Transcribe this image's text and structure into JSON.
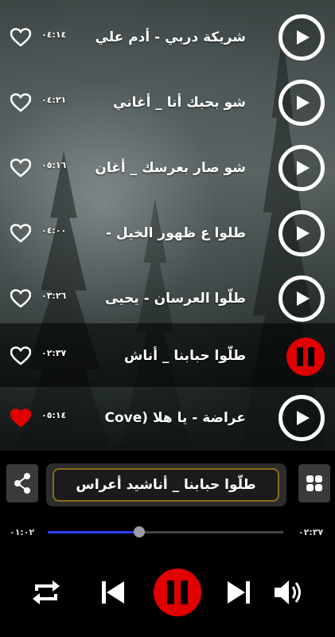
{
  "playlist": {
    "items": [
      {
        "title": "شريكة دربي - أدم علي",
        "duration": "٠٤:١٤",
        "favorite": false,
        "playing": false
      },
      {
        "title": "شو بحبك أنا _ أغاني",
        "duration": "٠٤:٢١",
        "favorite": false,
        "playing": false
      },
      {
        "title": "شو صار بعرسك _ أغان",
        "duration": "٠٥:١٦",
        "favorite": false,
        "playing": false
      },
      {
        "title": "طلوا ع ظهور الخيل -",
        "duration": "٠٤:٠٠",
        "favorite": false,
        "playing": false
      },
      {
        "title": "طلّوا العرسان - يحيى",
        "duration": "٠٣:٢٦",
        "favorite": false,
        "playing": false
      },
      {
        "title": "طلّوا حبابنا _ أناش",
        "duration": "٠٢:٣٧",
        "favorite": false,
        "playing": true
      },
      {
        "title": "عراضة - يا هلا (Cove",
        "duration": "٠٥:١٤",
        "favorite": true,
        "playing": false
      }
    ]
  },
  "player": {
    "now_playing": "طلّوا حبابنا _ أناشيد أعراس",
    "elapsed": "٠١:٠٢",
    "total": "٠٢:٣٧",
    "progress": 0.39
  },
  "colors": {
    "accent_red": "#e00000",
    "progress_blue": "#2a3ff0",
    "frame_gold": "#8a6a1e"
  },
  "icons": {
    "share": "share-icon",
    "grid": "grid-icon",
    "repeat": "repeat-icon",
    "previous": "skip-previous-icon",
    "pause": "pause-icon",
    "next": "skip-next-icon",
    "volume": "volume-icon",
    "favorite": "heart-icon",
    "play": "play-icon"
  }
}
